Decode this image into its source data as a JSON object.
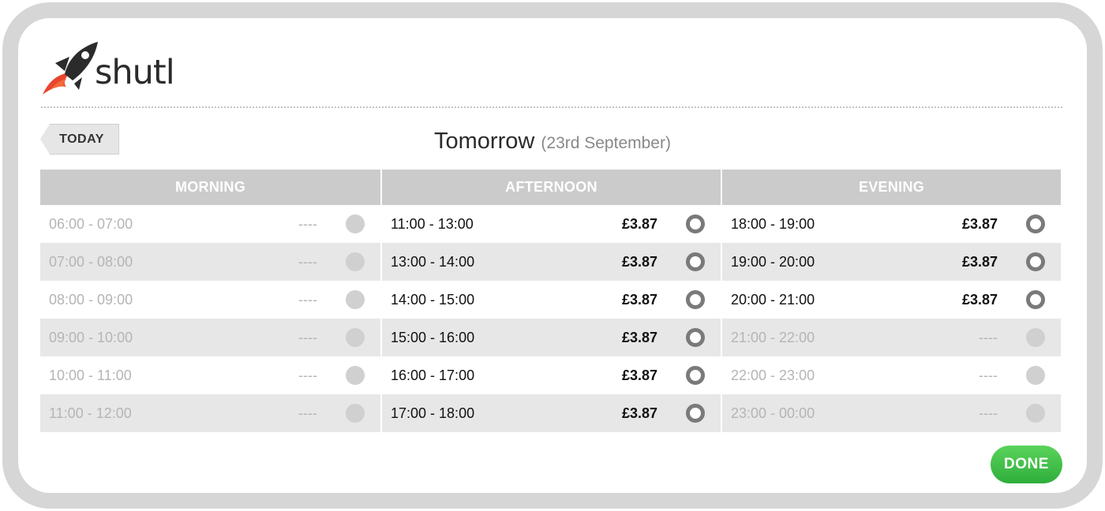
{
  "brand": {
    "name": "shutl"
  },
  "header": {
    "today_label": "TODAY",
    "title": "Tomorrow",
    "date": "(23rd September)"
  },
  "columns": [
    {
      "label": "MORNING",
      "slots": [
        {
          "time": "06:00 - 07:00",
          "price": "----",
          "available": false
        },
        {
          "time": "07:00 - 08:00",
          "price": "----",
          "available": false
        },
        {
          "time": "08:00 - 09:00",
          "price": "----",
          "available": false
        },
        {
          "time": "09:00 - 10:00",
          "price": "----",
          "available": false
        },
        {
          "time": "10:00 - 11:00",
          "price": "----",
          "available": false
        },
        {
          "time": "11:00 - 12:00",
          "price": "----",
          "available": false
        }
      ]
    },
    {
      "label": "AFTERNOON",
      "slots": [
        {
          "time": "11:00 - 13:00",
          "price": "£3.87",
          "available": true
        },
        {
          "time": "13:00 - 14:00",
          "price": "£3.87",
          "available": true
        },
        {
          "time": "14:00 - 15:00",
          "price": "£3.87",
          "available": true
        },
        {
          "time": "15:00 - 16:00",
          "price": "£3.87",
          "available": true
        },
        {
          "time": "16:00 - 17:00",
          "price": "£3.87",
          "available": true
        },
        {
          "time": "17:00 - 18:00",
          "price": "£3.87",
          "available": true
        }
      ]
    },
    {
      "label": "EVENING",
      "slots": [
        {
          "time": "18:00 - 19:00",
          "price": "£3.87",
          "available": true
        },
        {
          "time": "19:00 - 20:00",
          "price": "£3.87",
          "available": true
        },
        {
          "time": "20:00 - 21:00",
          "price": "£3.87",
          "available": true
        },
        {
          "time": "21:00 - 22:00",
          "price": "----",
          "available": false
        },
        {
          "time": "22:00 - 23:00",
          "price": "----",
          "available": false
        },
        {
          "time": "23:00 - 00:00",
          "price": "----",
          "available": false
        }
      ]
    }
  ],
  "footer": {
    "done_label": "DONE"
  },
  "colors": {
    "accent": "#2fae3c",
    "logo_red": "#e8452c",
    "logo_dark": "#2b2b2b"
  }
}
